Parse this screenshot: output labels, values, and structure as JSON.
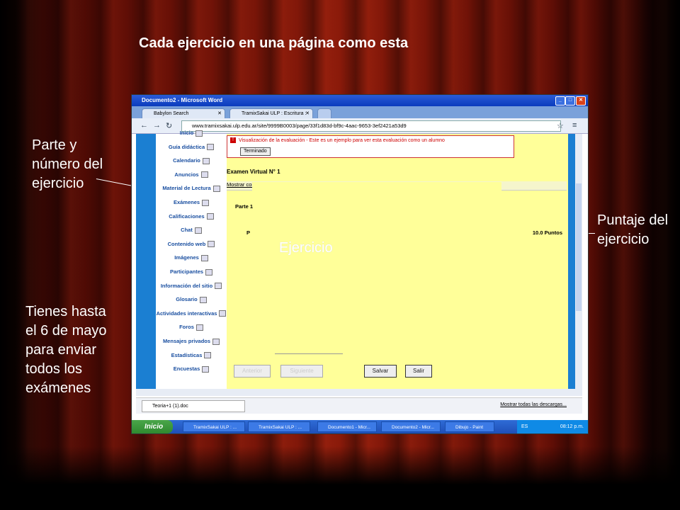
{
  "slide": {
    "title": "Cada ejercicio en una página como esta",
    "note_parte": "Parte y número del ejercicio",
    "note_plazo": "Tienes hasta el 6 de mayo para enviar todos los exámenes",
    "note_puntaje": "Puntaje del ejercicio"
  },
  "window": {
    "title": "Documento2 - Microsoft Word",
    "tabs": [
      {
        "label": "Babylon Search"
      },
      {
        "label": "TramixSakai ULP : Escritura :"
      }
    ],
    "url": "www.tramixsakai.ulp.edu.ar/site/9999B0003/page/33f1d83d-bf9c-4aac-9653-3ef2421a53d9",
    "url_domain": "www.tramixsakai.ulp.edu.ar"
  },
  "sidebar": {
    "items": [
      "Inicio",
      "Guía didáctica",
      "Calendario",
      "Anuncios",
      "Material de Lectura",
      "Exámenes",
      "Calificaciones",
      "Chat",
      "Contenido web",
      "Imágenes",
      "Participantes",
      "Información del sitio",
      "Glosario",
      "Actividades interactivas",
      "Foros",
      "Mensajes privados",
      "Estadísticas",
      "Encuestas"
    ]
  },
  "main": {
    "alert": "Visualización de la evaluación - Este es un ejemplo para ver esta evaluación como un alumno",
    "terminado": "Terminado",
    "exam_title": "Examen Virtual N° 1",
    "mostrar": "Mostrar comentarios",
    "parte": "Parte 1",
    "p_letter": "P",
    "puntos": "10.0 Puntos",
    "ejercicio": "Ejercicio",
    "buttons": {
      "anterior": "Anterior",
      "siguiente": "Siguiente",
      "salvar": "Salvar",
      "salir": "Salir"
    }
  },
  "download_bar": {
    "file": "Teoria+1 (1).doc",
    "show_all": "Mostrar todas las descargas..."
  },
  "taskbar": {
    "start": "Inicio",
    "tasks": [
      "TramixSakai ULP : ...",
      "TramixSakai ULP : ...",
      "Documento1 - Micr...",
      "Documento2 - Micr...",
      "Dibujo - Paint"
    ],
    "lang": "ES",
    "clock": "08:12 p.m."
  }
}
